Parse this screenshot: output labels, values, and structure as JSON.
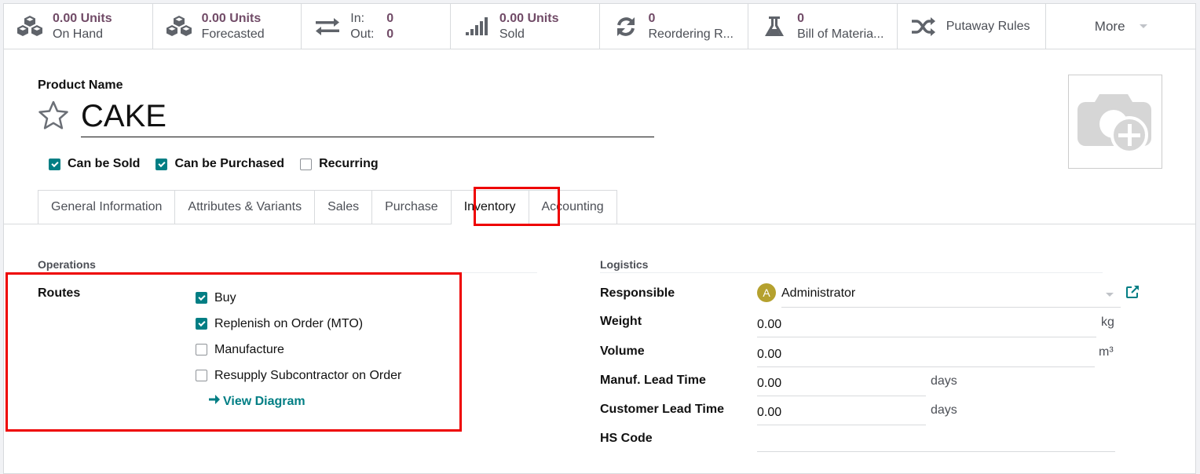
{
  "smart_buttons": [
    {
      "icon": "cubes-icon",
      "value": "0.00 Units",
      "label": "On Hand"
    },
    {
      "icon": "cubes-icon",
      "value": "0.00 Units",
      "label": "Forecasted"
    },
    {
      "icon": "exchange-icon",
      "in_label": "In:",
      "in_value": "0",
      "out_label": "Out:",
      "out_value": "0"
    },
    {
      "icon": "signal-icon",
      "value": "0.00 Units",
      "label": "Sold"
    },
    {
      "icon": "refresh-icon",
      "value": "0",
      "label": "Reordering R..."
    },
    {
      "icon": "flask-icon",
      "value": "0",
      "label": "Bill of Materia..."
    },
    {
      "icon": "random-icon",
      "label": "Putaway Rules"
    }
  ],
  "more_label": "More",
  "product": {
    "name_label": "Product Name",
    "name": "CAKE",
    "favorite": false,
    "flags": [
      {
        "label": "Can be Sold",
        "checked": true
      },
      {
        "label": "Can be Purchased",
        "checked": true
      },
      {
        "label": "Recurring",
        "checked": false
      }
    ]
  },
  "tabs": [
    {
      "label": "General Information",
      "active": false
    },
    {
      "label": "Attributes & Variants",
      "active": false
    },
    {
      "label": "Sales",
      "active": false
    },
    {
      "label": "Purchase",
      "active": false
    },
    {
      "label": "Inventory",
      "active": true
    },
    {
      "label": "Accounting",
      "active": false
    }
  ],
  "operations": {
    "title": "Operations",
    "routes_label": "Routes",
    "routes": [
      {
        "label": "Buy",
        "checked": true
      },
      {
        "label": "Replenish on Order (MTO)",
        "checked": true
      },
      {
        "label": "Manufacture",
        "checked": false
      },
      {
        "label": "Resupply Subcontractor on Order",
        "checked": false
      }
    ],
    "view_diagram": "View Diagram"
  },
  "logistics": {
    "title": "Logistics",
    "responsible_label": "Responsible",
    "responsible_initial": "A",
    "responsible_value": "Administrator",
    "weight_label": "Weight",
    "weight_value": "0.00",
    "weight_unit": "kg",
    "volume_label": "Volume",
    "volume_value": "0.00",
    "volume_unit": "m³",
    "manuf_lead_label": "Manuf. Lead Time",
    "manuf_lead_value": "0.00",
    "manuf_lead_unit": "days",
    "customer_lead_label": "Customer Lead Time",
    "customer_lead_value": "0.00",
    "customer_lead_unit": "days",
    "hs_code_label": "HS Code",
    "hs_code_value": ""
  },
  "colors": {
    "accent": "#017e84",
    "brand": "#714b67",
    "highlight": "#ee0000",
    "avatar": "#b5a12e"
  }
}
